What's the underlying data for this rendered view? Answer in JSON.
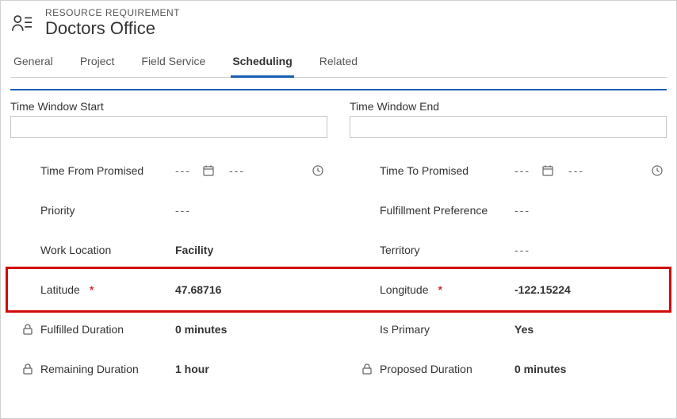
{
  "header": {
    "entity_type": "RESOURCE REQUIREMENT",
    "title": "Doctors Office"
  },
  "tabs": {
    "items": [
      "General",
      "Project",
      "Field Service",
      "Scheduling",
      "Related"
    ],
    "active_index": 3
  },
  "left": {
    "section_label": "Time Window Start",
    "section_value": "",
    "fields": [
      {
        "label": "Time From Promised",
        "value": "---",
        "datetime": true
      },
      {
        "label": "Priority",
        "value": "---"
      },
      {
        "label": "Work Location",
        "value": "Facility",
        "bold": true
      },
      {
        "label": "Latitude",
        "value": "47.68716",
        "bold": true,
        "required": true,
        "highlight": true
      },
      {
        "label": "Fulfilled Duration",
        "value": "0 minutes",
        "bold": true,
        "locked": true
      },
      {
        "label": "Remaining Duration",
        "value": "1 hour",
        "bold": true,
        "locked": true
      }
    ]
  },
  "right": {
    "section_label": "Time Window End",
    "section_value": "",
    "fields": [
      {
        "label": "Time To Promised",
        "value": "---",
        "datetime": true
      },
      {
        "label": "Fulfillment Preference",
        "value": "---"
      },
      {
        "label": "Territory",
        "value": "---"
      },
      {
        "label": "Longitude",
        "value": "-122.15224",
        "bold": true,
        "required": true,
        "highlight": true
      },
      {
        "label": "Is Primary",
        "value": "Yes",
        "bold": true
      },
      {
        "label": "Proposed Duration",
        "value": "0 minutes",
        "bold": true,
        "locked": true
      }
    ]
  },
  "placeholders": {
    "triple_dash": "---"
  }
}
